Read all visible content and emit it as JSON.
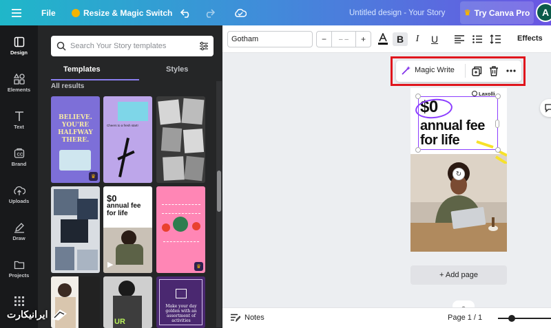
{
  "topbar": {
    "file_label": "File",
    "magic_switch_label": "Resize & Magic Switch",
    "design_title": "Untitled design - Your Story",
    "try_pro_label": "Try Canva Pro",
    "avatar_initial": "A"
  },
  "rail": {
    "items": [
      {
        "label": "Design",
        "icon": "design-icon"
      },
      {
        "label": "Elements",
        "icon": "elements-icon"
      },
      {
        "label": "Text",
        "icon": "text-icon"
      },
      {
        "label": "Brand",
        "icon": "brand-icon"
      },
      {
        "label": "Uploads",
        "icon": "uploads-icon"
      },
      {
        "label": "Draw",
        "icon": "draw-icon"
      },
      {
        "label": "Projects",
        "icon": "projects-icon"
      },
      {
        "label": "Apps",
        "icon": "apps-icon"
      }
    ]
  },
  "panel": {
    "search_placeholder": "Search Your Story templates",
    "tabs": [
      "Templates",
      "Styles"
    ],
    "results_label": "All results",
    "thumb1": {
      "lines": [
        "BELIEVE.",
        "YOU'RE",
        "HALFWAY",
        "THERE."
      ]
    },
    "thumb2": {
      "caption": "Cheers to a fresh start!"
    },
    "thumb5": {
      "line1": "$0",
      "line2": "annual fee",
      "line3": "for life"
    },
    "thumb9": {
      "text": "Make your day golden with an assortment of activities"
    }
  },
  "toolbar": {
    "font": "Gotham",
    "size_minus": "−",
    "size_value": "– –",
    "size_plus": "+",
    "bold": "B",
    "italic": "I",
    "underline": "U",
    "effects": "Effects"
  },
  "floating": {
    "magic_write_label": "Magic Write"
  },
  "page": {
    "brand": "Laxolli",
    "headline_1": "$0",
    "headline_2": "annual fee",
    "headline_3": "for life"
  },
  "canvas": {
    "add_page_label": "+ Add page"
  },
  "footer": {
    "notes_label": "Notes",
    "page_count": "Page 1 / 1"
  },
  "watermark": {
    "text": "ایرانیکارت"
  },
  "colors": {
    "accent": "#8b3dff",
    "highlight": "#e0141c",
    "crown": "#f4b400"
  }
}
